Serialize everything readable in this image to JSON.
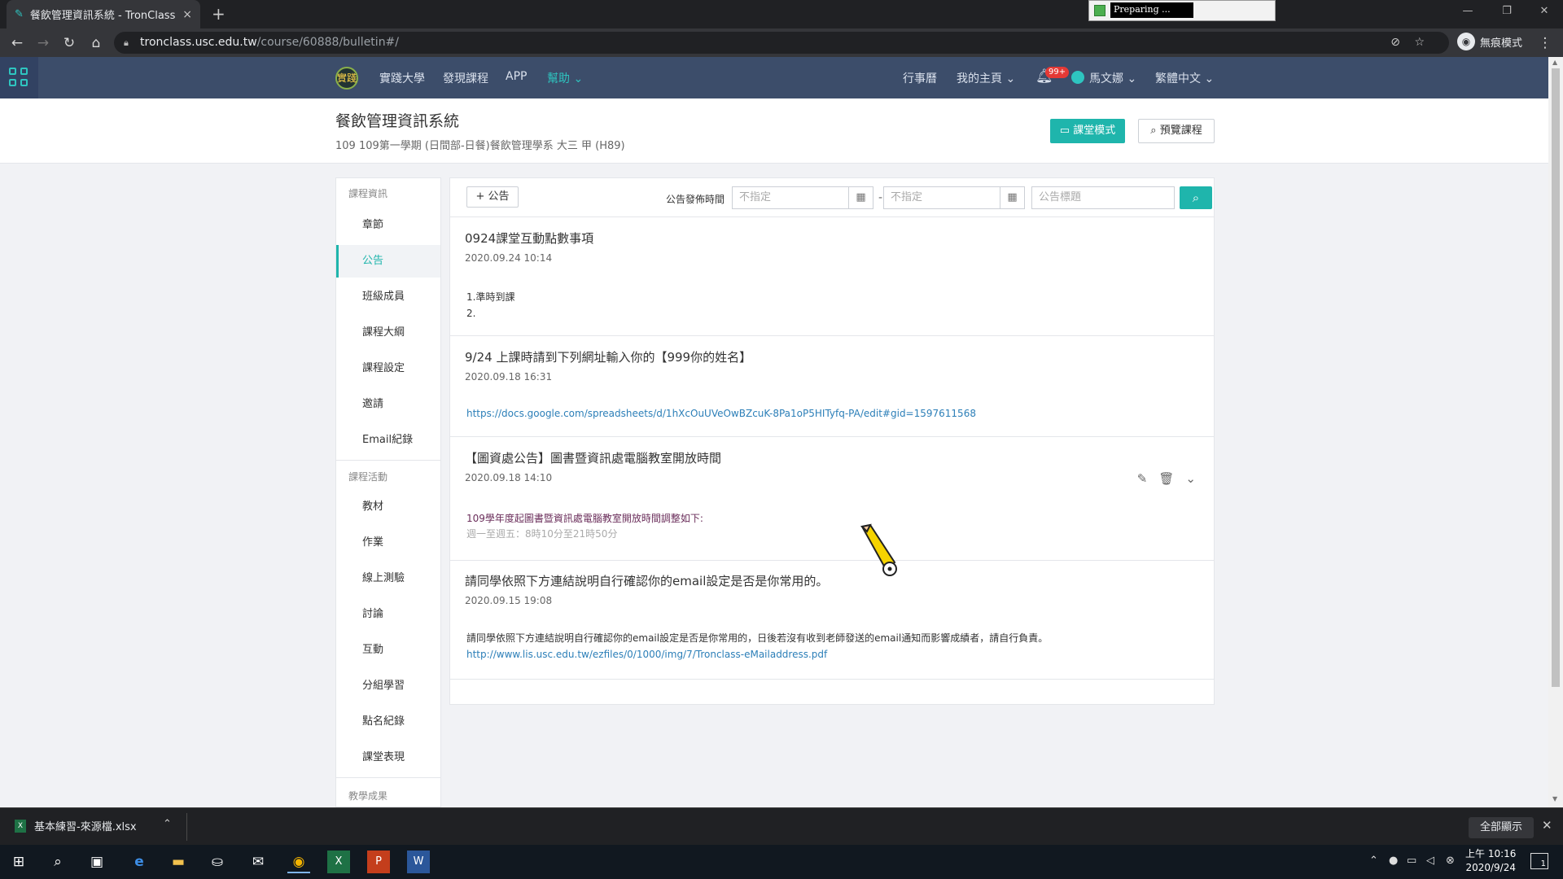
{
  "browser": {
    "tab_title": "餐飲管理資訊系統 - TronClass",
    "tab_close": "×",
    "new_tab": "+",
    "preparing_text": "Preparing ...",
    "url_host": "tronclass.usc.edu.tw",
    "url_path": "/course/60888/bulletin#/",
    "incognito_label": "無痕模式"
  },
  "sitenav": {
    "logo_text": "實踐",
    "links": [
      "實踐大學",
      "發現課程",
      "APP",
      "幫助"
    ],
    "calendar": "行事曆",
    "my_home": "我的主頁",
    "badge": "99+",
    "user": "馬文娜",
    "language": "繁體中文"
  },
  "course": {
    "title": "餐飲管理資訊系統",
    "subtitle": "109 109第一學期 (日間部-日餐)餐飲管理學系 大三 甲 (H89)",
    "classroom_mode": "課堂模式",
    "preview": "預覽課程"
  },
  "sidebar": {
    "sections": [
      "課程資訊",
      "課程活動",
      "教學成果"
    ],
    "info_items": [
      "章節",
      "公告",
      "班級成員",
      "課程大綱",
      "課程設定",
      "邀請",
      "Email紀錄"
    ],
    "activity_items": [
      "教材",
      "作業",
      "線上測驗",
      "討論",
      "互動",
      "分組學習",
      "點名紀錄",
      "課堂表現"
    ],
    "active": "公告"
  },
  "toolbar": {
    "add_label": "公告",
    "time_label": "公告發佈時間",
    "date_placeholder": "不指定",
    "title_placeholder": "公告標題"
  },
  "posts": [
    {
      "title": "0924課堂互動點數事項",
      "date": "2020.09.24 10:14",
      "lines": [
        "1.準時到課",
        "2."
      ]
    },
    {
      "title": "9/24 上課時請到下列網址輸入你的【999你的姓名】",
      "date": "2020.09.18 16:31",
      "link": "https://docs.google.com/spreadsheets/d/1hXcOuUVeOwBZcuK-8Pa1oP5HITyfq-PA/edit#gid=1597611568"
    },
    {
      "title": "【圖資處公告】圖書暨資訊處電腦教室開放時間",
      "date": "2020.09.18 14:10",
      "lines": [
        "109學年度起圖書暨資訊處電腦教室開放時間調整如下:",
        "週一至週五：8時10分至21時50分"
      ]
    },
    {
      "title": "請同學依照下方連結說明自行確認你的email設定是否是你常用的。",
      "date": "2020.09.15 19:08",
      "lines": [
        "請同學依照下方連結說明自行確認你的email設定是否是你常用的，日後若沒有收到老師發送的email通知而影響成績者，請自行負責。"
      ],
      "link": "http://www.lis.usc.edu.tw/ezfiles/0/1000/img/7/Tronclass-eMailaddress.pdf"
    }
  ],
  "download": {
    "file": "基本練習-來源檔.xlsx",
    "show_all": "全部顯示"
  },
  "taskbar": {
    "time": "上午 10:16",
    "date": "2020/9/24",
    "notifications": "1"
  },
  "colors": {
    "accent": "#1fb5ac",
    "nav_bg": "#3c4d6a",
    "link": "#2c7fb8"
  }
}
